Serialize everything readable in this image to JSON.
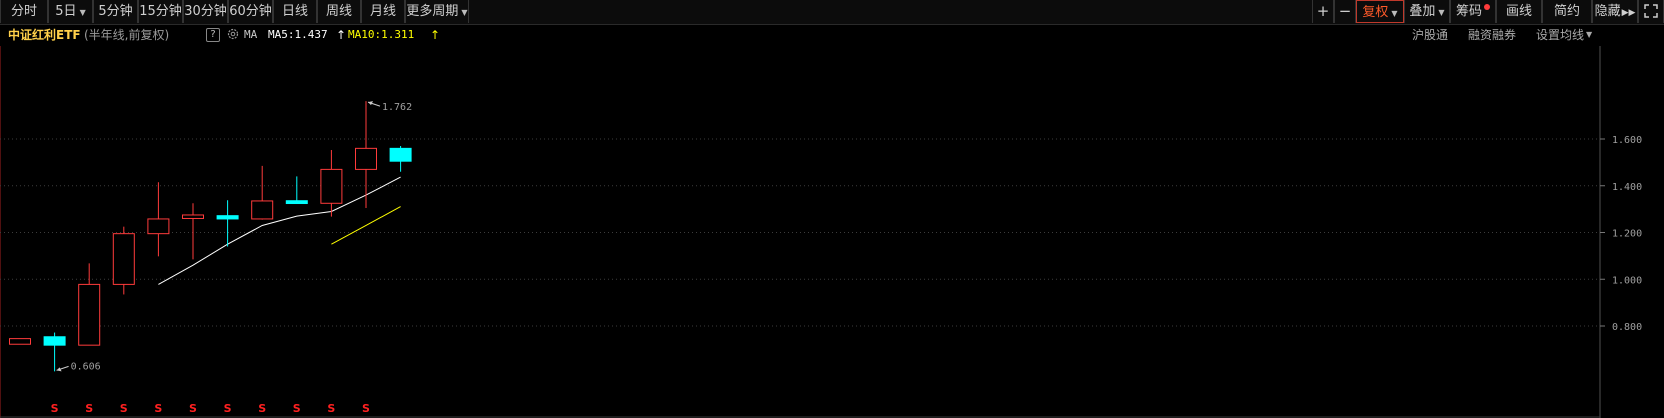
{
  "toolbar": {
    "left_buttons": [
      "分时",
      "5日",
      "5分钟",
      "15分钟",
      "30分钟",
      "60分钟",
      "日线",
      "周线",
      "月线",
      "更多周期"
    ],
    "plus_icon": "+",
    "minus_icon": "−",
    "fuquan_label": "复权",
    "diejia_label": "叠加",
    "chouma_label": "筹码",
    "huaxian_label": "画线",
    "jianyue_label": "简约",
    "yincang_label": "隐藏",
    "expand_icon": "expand-icon"
  },
  "info": {
    "name": "中证红利ETF",
    "mode": "(半年线,前复权)",
    "help": "?",
    "ma_label": "MA",
    "ma5": "MA5:1.437",
    "ma10": "MA10:1.311",
    "hugutong": "沪股通",
    "rongzi": "融资融券",
    "set_ma": "设置均线"
  },
  "colors": {
    "up": "#ff3b3b",
    "down": "#00ffff",
    "ma5": "#ffffff",
    "ma10": "#ffff00",
    "dividend_marker": "#ff2020"
  },
  "chart_data": {
    "type": "candlestick",
    "ylim": [
      0.55,
      1.82
    ],
    "yticks": [
      "1.600",
      "1.400",
      "1.200",
      "1.000",
      "0.800"
    ],
    "ytick_values": [
      1.6,
      1.4,
      1.2,
      1.0,
      0.8
    ],
    "candles": [
      {
        "o": 0.722,
        "c": 0.746,
        "h": 0.746,
        "l": 0.722
      },
      {
        "o": 0.754,
        "c": 0.718,
        "h": 0.772,
        "l": 0.606
      },
      {
        "o": 0.718,
        "c": 0.978,
        "h": 1.068,
        "l": 0.718
      },
      {
        "o": 0.978,
        "c": 1.195,
        "h": 1.225,
        "l": 0.935
      },
      {
        "o": 1.195,
        "c": 1.258,
        "h": 1.415,
        "l": 1.098
      },
      {
        "o": 1.26,
        "c": 1.275,
        "h": 1.325,
        "l": 1.085
      },
      {
        "o": 1.272,
        "c": 1.258,
        "h": 1.338,
        "l": 1.14
      },
      {
        "o": 1.258,
        "c": 1.335,
        "h": 1.485,
        "l": 1.255
      },
      {
        "o": 1.336,
        "c": 1.324,
        "h": 1.44,
        "l": 1.324
      },
      {
        "o": 1.325,
        "c": 1.47,
        "h": 1.553,
        "l": 1.268
      },
      {
        "o": 1.47,
        "c": 1.56,
        "h": 1.762,
        "l": 1.305
      },
      {
        "o": 1.56,
        "c": 1.505,
        "h": 1.57,
        "l": 1.46
      }
    ],
    "ma5": [
      null,
      null,
      null,
      null,
      0.978,
      1.06,
      1.15,
      1.23,
      1.27,
      1.29,
      1.36,
      1.437
    ],
    "ma10": [
      null,
      null,
      null,
      null,
      null,
      null,
      null,
      null,
      null,
      1.15,
      1.23,
      1.311
    ],
    "annotations": {
      "high": "1.762",
      "low": "0.606"
    },
    "dividend_markers": [
      1,
      2,
      3,
      4,
      5,
      6,
      7,
      8,
      9,
      10
    ],
    "dividend_symbol": "S"
  }
}
